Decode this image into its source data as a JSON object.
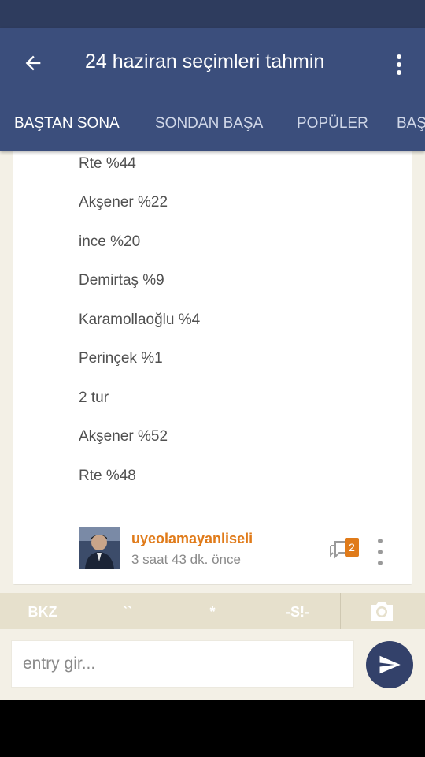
{
  "app_bar": {
    "title": "24 haziran seçimleri tahmin",
    "icons": {
      "back": "arrow-left-icon",
      "menu": "more-vertical-icon"
    }
  },
  "tabs": [
    {
      "label": "BAŞTAN SONA",
      "active": true
    },
    {
      "label": "SONDAN BAŞA",
      "active": false
    },
    {
      "label": "POPÜLER",
      "active": false
    },
    {
      "label": "BAŞ",
      "active": false
    }
  ],
  "entry": {
    "lines": [
      "Rte %44",
      "Akşener %22",
      "ince %20",
      "Demirtaş %9",
      "Karamollaoğlu %4",
      "Perinçek %1",
      "2 tur",
      "Akşener %52",
      "Rte %48"
    ],
    "author": "uyeolamayanliseli",
    "time": "3 saat 43 dk. önce",
    "comment_count": "2"
  },
  "shortcuts": [
    "BKZ",
    "``",
    "*",
    "-S!-"
  ],
  "composer": {
    "placeholder": "entry gir...",
    "icons": {
      "camera": "camera-icon",
      "send": "send-icon"
    }
  },
  "colors": {
    "status_bar": "#2e3c5e",
    "app_bar": "#3b4e7c",
    "accent": "#e07b1a",
    "background": "#f3f0e6",
    "send_button": "#33416a"
  }
}
